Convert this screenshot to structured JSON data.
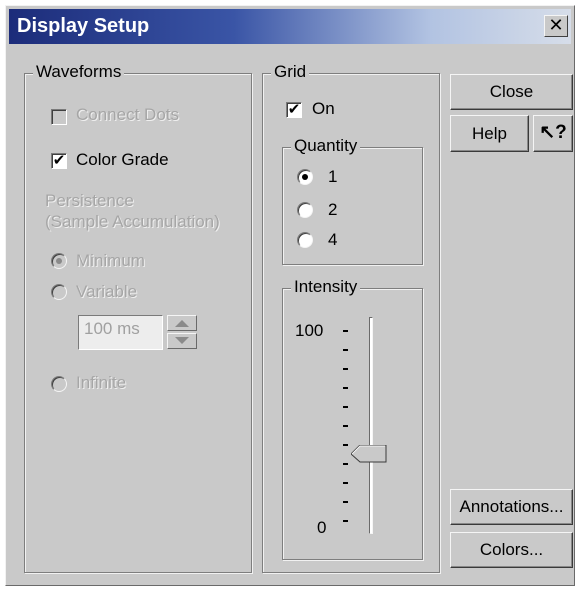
{
  "window": {
    "title": "Display Setup",
    "close_glyph": "✕"
  },
  "waveforms": {
    "title": "Waveforms",
    "connect_dots": {
      "label": "Connect Dots",
      "checked": false
    },
    "color_grade": {
      "label": "Color Grade",
      "checked": true
    },
    "persistence_line1": "Persistence",
    "persistence_line2": "(Sample Accumulation)",
    "minimum": {
      "label": "Minimum",
      "selected": true
    },
    "variable": {
      "label": "Variable",
      "selected": false
    },
    "variable_value": "100 ms",
    "infinite": {
      "label": "Infinite",
      "selected": false
    }
  },
  "grid": {
    "title": "Grid",
    "on": {
      "label": "On",
      "checked": true
    },
    "quantity": {
      "title": "Quantity",
      "options": [
        "1",
        "2",
        "4"
      ],
      "selected": "1"
    },
    "intensity": {
      "title": "Intensity",
      "max_label": "100",
      "min_label": "0",
      "value": 40
    }
  },
  "buttons": {
    "close": "Close",
    "help": "Help",
    "whats_this_glyph": "↖?",
    "annotations": "Annotations...",
    "colors": "Colors..."
  },
  "icons": {
    "close": "close-icon",
    "whats_this": "whats-this-help-icon",
    "spin_up": "triangle-up-icon",
    "spin_down": "triangle-down-icon",
    "check": "checkmark-icon"
  }
}
